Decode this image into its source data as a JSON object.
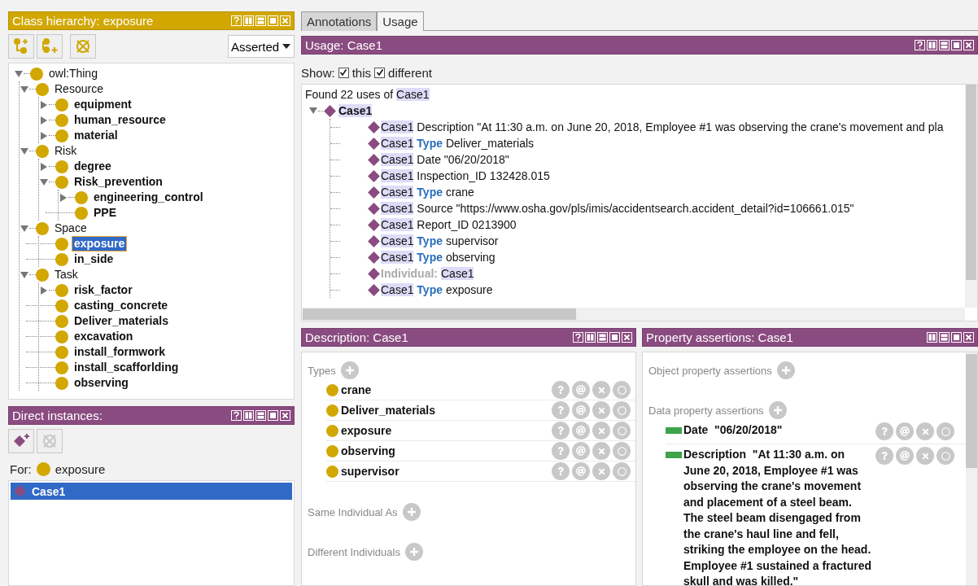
{
  "class_hierarchy": {
    "title": "Class hierarchy: exposure",
    "kind": "class",
    "has_help": true,
    "toolbar": [
      {
        "kind": "add-subclass",
        "disabled": false
      },
      {
        "kind": "add-sibling",
        "disabled": false
      },
      {
        "kind": "delete",
        "disabled": false
      }
    ],
    "view": "Asserted",
    "tree": [
      {
        "label": "owl:Thing",
        "kind": "branch",
        "expanded": true,
        "bold": false,
        "selected": false,
        "children": [
          {
            "label": "Resource",
            "kind": "branch",
            "expanded": true,
            "bold": false,
            "selected": false,
            "children": [
              {
                "label": "equipment",
                "kind": "branch",
                "expanded": false,
                "bold": true,
                "selected": false
              },
              {
                "label": "human_resource",
                "kind": "branch",
                "expanded": false,
                "bold": true,
                "selected": false
              },
              {
                "label": "material",
                "kind": "branch",
                "expanded": false,
                "bold": true,
                "selected": false
              }
            ]
          },
          {
            "label": "Risk",
            "kind": "branch",
            "expanded": true,
            "bold": false,
            "selected": false,
            "children": [
              {
                "label": "degree",
                "kind": "branch",
                "expanded": false,
                "bold": true,
                "selected": false
              },
              {
                "label": "Risk_prevention",
                "kind": "branch",
                "expanded": true,
                "bold": true,
                "selected": false,
                "children": [
                  {
                    "label": "engineering_control",
                    "kind": "branch",
                    "expanded": false,
                    "bold": true,
                    "selected": false
                  },
                  {
                    "label": "PPE",
                    "kind": "leaf",
                    "bold": true,
                    "selected": false
                  }
                ]
              }
            ]
          },
          {
            "label": "Space",
            "kind": "branch",
            "expanded": true,
            "bold": false,
            "selected": false,
            "children": [
              {
                "label": "exposure",
                "kind": "leaf",
                "bold": true,
                "selected": true
              },
              {
                "label": "in_side",
                "kind": "leaf",
                "bold": true,
                "selected": false
              }
            ]
          },
          {
            "label": "Task",
            "kind": "branch",
            "expanded": true,
            "bold": false,
            "selected": false,
            "children": [
              {
                "label": "risk_factor",
                "kind": "branch",
                "expanded": false,
                "bold": true,
                "selected": false
              },
              {
                "label": "casting_concrete",
                "kind": "leaf",
                "bold": true,
                "selected": false
              },
              {
                "label": "Deliver_materials",
                "kind": "leaf",
                "bold": true,
                "selected": false
              },
              {
                "label": "excavation",
                "kind": "leaf",
                "bold": true,
                "selected": false
              },
              {
                "label": "install_formwork",
                "kind": "leaf",
                "bold": true,
                "selected": false
              },
              {
                "label": "install_scafforlding",
                "kind": "leaf",
                "bold": true,
                "selected": false
              },
              {
                "label": "observing",
                "kind": "leaf",
                "bold": true,
                "selected": false
              }
            ]
          }
        ]
      }
    ]
  },
  "direct_instances": {
    "title": "Direct instances:",
    "kind": "individual",
    "has_help": true,
    "toolbar": [
      {
        "kind": "add-individual",
        "disabled": false
      },
      {
        "kind": "delete",
        "disabled": true
      }
    ],
    "for_label": "For:",
    "for_class": "exposure",
    "items": [
      {
        "label": "Case1",
        "selected": true
      }
    ]
  },
  "tabs": [
    {
      "label": "Annotations",
      "selected": false
    },
    {
      "label": "Usage",
      "selected": true
    }
  ],
  "usage": {
    "title": "Usage: Case1",
    "kind": "individual",
    "has_help": true,
    "show_label": "Show:",
    "filters": [
      {
        "label": "this",
        "checked": true
      },
      {
        "label": "different",
        "checked": true
      }
    ],
    "summary": [
      {
        "text": "Found 22 uses of ",
        "kind": "plain"
      },
      {
        "text": "Case1",
        "kind": "entity"
      }
    ],
    "root": {
      "label": "Case1",
      "expanded": true
    },
    "rows": [
      {
        "parts": [
          {
            "text": "Case1",
            "kind": "entity"
          },
          {
            "text": " Description \"At 11:30 a.m. on June 20, 2018, Employee #1 was observing the crane's movement and pla",
            "kind": "plain"
          }
        ]
      },
      {
        "parts": [
          {
            "text": "Case1",
            "kind": "entity"
          },
          {
            "text": " Type",
            "kind": "keyword"
          },
          {
            "text": " Deliver_materials",
            "kind": "plain"
          }
        ]
      },
      {
        "parts": [
          {
            "text": "Case1",
            "kind": "entity"
          },
          {
            "text": " Date \"06/20/2018\"",
            "kind": "plain"
          }
        ]
      },
      {
        "parts": [
          {
            "text": "Case1",
            "kind": "entity"
          },
          {
            "text": " Inspection_ID 132428.015",
            "kind": "plain"
          }
        ]
      },
      {
        "parts": [
          {
            "text": "Case1",
            "kind": "entity"
          },
          {
            "text": " Type",
            "kind": "keyword"
          },
          {
            "text": " crane",
            "kind": "plain"
          }
        ]
      },
      {
        "parts": [
          {
            "text": "Case1",
            "kind": "entity"
          },
          {
            "text": " Source \"https://www.osha.gov/pls/imis/accidentsearch.accident_detail?id=106661.015\"",
            "kind": "plain"
          }
        ]
      },
      {
        "parts": [
          {
            "text": "Case1",
            "kind": "entity"
          },
          {
            "text": " Report_ID 0213900",
            "kind": "plain"
          }
        ]
      },
      {
        "parts": [
          {
            "text": "Case1",
            "kind": "entity"
          },
          {
            "text": " Type",
            "kind": "keyword"
          },
          {
            "text": " supervisor",
            "kind": "plain"
          }
        ]
      },
      {
        "parts": [
          {
            "text": "Case1",
            "kind": "entity"
          },
          {
            "text": " Type",
            "kind": "keyword"
          },
          {
            "text": " observing",
            "kind": "plain"
          }
        ]
      },
      {
        "parts": [
          {
            "text": "Individual:",
            "kind": "muted"
          },
          {
            "text": "Case1",
            "kind": "entity"
          }
        ]
      },
      {
        "parts": [
          {
            "text": "Case1",
            "kind": "entity"
          },
          {
            "text": " Type",
            "kind": "keyword"
          },
          {
            "text": " exposure",
            "kind": "plain"
          }
        ]
      }
    ]
  },
  "description": {
    "title": "Description: Case1",
    "kind": "individual",
    "has_help": true,
    "sections": [
      {
        "label": "Types",
        "items": [
          {
            "label": "crane"
          },
          {
            "label": "Deliver_materials"
          },
          {
            "label": "exposure"
          },
          {
            "label": "observing"
          },
          {
            "label": "supervisor"
          }
        ]
      },
      {
        "label": "Same Individual As"
      },
      {
        "label": "Different Individuals"
      }
    ]
  },
  "property_assertions": {
    "title": "Property assertions: Case1",
    "kind": "individual",
    "has_help": false,
    "sections": [
      {
        "label": "Object property assertions"
      },
      {
        "label": "Data property assertions",
        "items": [
          {
            "text": "Date  \"06/20/2018\""
          },
          {
            "text": "Description  \"At 11:30 a.m. on June 20, 2018, Employee #1 was observing the crane's movement and placement of a steel beam. The steel beam disengaged from the crane's haul line and fell, striking the employee on the head. Employee #1 sustained a fractured skull and was killed.\""
          }
        ]
      }
    ]
  }
}
